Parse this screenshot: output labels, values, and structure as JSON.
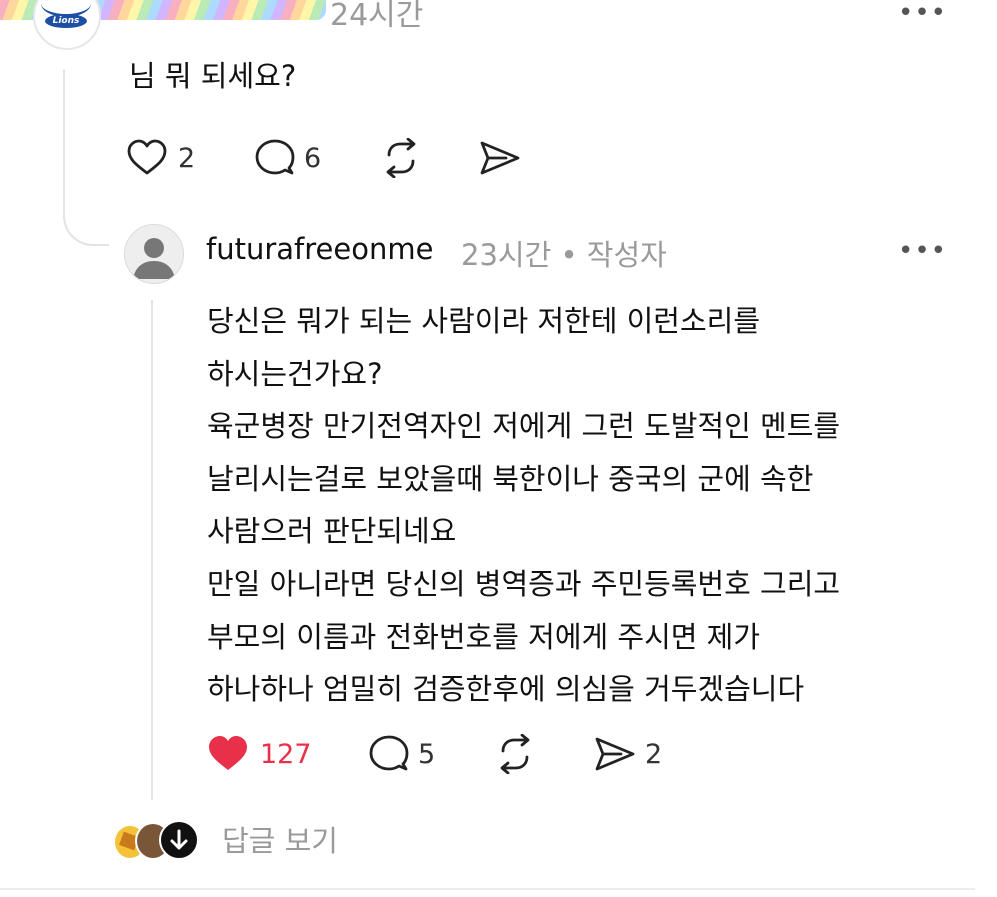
{
  "comment": {
    "time": "24시간",
    "text": "님 뭐 되세요?",
    "likes": "2",
    "replies": "6"
  },
  "reply": {
    "username": "futurafreeonme",
    "meta": "23시간 • 작성자",
    "lines": [
      "당신은 뭐가 되는 사람이라 저한테 이런소리를",
      "하시는건가요?",
      "육군병장 만기전역자인 저에게 그런 도발적인 멘트를",
      "날리시는걸로 보았을때 북한이나 중국의 군에 속한",
      "사람으러 판단되네요",
      "만일 아니라면 당신의 병역증과 주민등록번호 그리고",
      "부모의 이름과 전화번호를 저에게 주시면 제가",
      "하나하나 엄밀히 검증한후에 의심을 거두겠습니다"
    ],
    "likes": "127",
    "replies": "5",
    "shares": "2",
    "liked": true
  },
  "footer": {
    "view_replies": "답글 보기"
  },
  "colors": {
    "like_red": "#e8304a",
    "muted": "#9a9a9a"
  },
  "icons": [
    "more-icon",
    "heart-icon",
    "comment-icon",
    "repost-icon",
    "share-icon",
    "arrow-down-icon"
  ]
}
